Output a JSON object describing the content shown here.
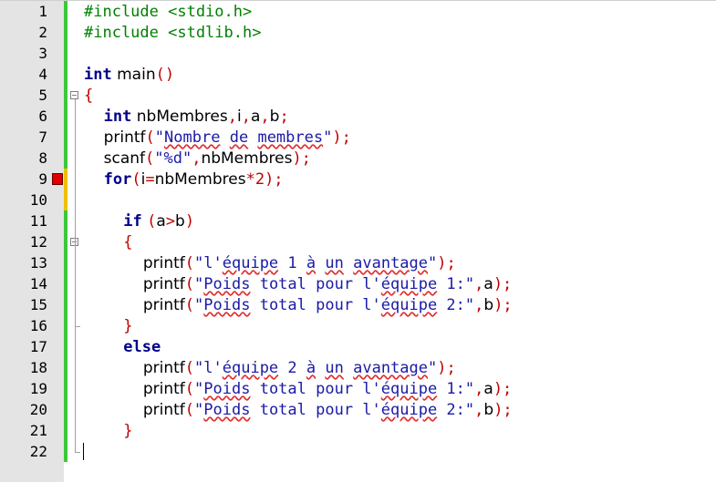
{
  "editor": {
    "line_numbers": [
      "1",
      "2",
      "3",
      "4",
      "5",
      "6",
      "7",
      "8",
      "9",
      "10",
      "11",
      "12",
      "13",
      "14",
      "15",
      "16",
      "17",
      "18",
      "19",
      "20",
      "21",
      "22"
    ],
    "lines": [
      [
        {
          "t": "pre",
          "v": "#include <stdio.h>"
        }
      ],
      [
        {
          "t": "pre",
          "v": "#include <stdlib.h>"
        }
      ],
      [],
      [
        {
          "t": "kw",
          "v": "int"
        },
        {
          "t": "id",
          "v": " main"
        },
        {
          "t": "op",
          "v": "()"
        }
      ],
      [
        {
          "t": "op",
          "v": "{"
        }
      ],
      [
        {
          "t": "id",
          "v": "    "
        },
        {
          "t": "kw",
          "v": "int"
        },
        {
          "t": "id",
          "v": " nbMembres"
        },
        {
          "t": "op",
          "v": ","
        },
        {
          "t": "id",
          "v": "i"
        },
        {
          "t": "op",
          "v": ","
        },
        {
          "t": "id",
          "v": "a"
        },
        {
          "t": "op",
          "v": ","
        },
        {
          "t": "id",
          "v": "b"
        },
        {
          "t": "op",
          "v": ";"
        }
      ],
      [
        {
          "t": "id",
          "v": "    printf"
        },
        {
          "t": "op",
          "v": "("
        },
        {
          "t": "str",
          "v": "\""
        },
        {
          "t": "str",
          "sq": true,
          "v": "Nombre"
        },
        {
          "t": "str",
          "v": " "
        },
        {
          "t": "str",
          "sq": true,
          "v": "de"
        },
        {
          "t": "str",
          "v": " "
        },
        {
          "t": "str",
          "sq": true,
          "v": "membres"
        },
        {
          "t": "str",
          "v": "\""
        },
        {
          "t": "op",
          "v": ");"
        }
      ],
      [
        {
          "t": "id",
          "v": "    scanf"
        },
        {
          "t": "op",
          "v": "("
        },
        {
          "t": "str",
          "v": "\"%d\""
        },
        {
          "t": "op",
          "v": ","
        },
        {
          "t": "id",
          "v": "nbMembres"
        },
        {
          "t": "op",
          "v": ");"
        }
      ],
      [
        {
          "t": "id",
          "v": "    "
        },
        {
          "t": "kw",
          "v": "for"
        },
        {
          "t": "op",
          "v": "("
        },
        {
          "t": "id",
          "v": "i"
        },
        {
          "t": "op",
          "v": "="
        },
        {
          "t": "id",
          "v": "nbMembres"
        },
        {
          "t": "op",
          "v": "*"
        },
        {
          "t": "num",
          "v": "2"
        },
        {
          "t": "op",
          "v": ");"
        }
      ],
      [],
      [
        {
          "t": "id",
          "v": "        "
        },
        {
          "t": "kw",
          "v": "if"
        },
        {
          "t": "id",
          "v": " "
        },
        {
          "t": "op",
          "v": "("
        },
        {
          "t": "id",
          "v": "a"
        },
        {
          "t": "op",
          "v": ">"
        },
        {
          "t": "id",
          "v": "b"
        },
        {
          "t": "op",
          "v": ")"
        }
      ],
      [
        {
          "t": "id",
          "v": "        "
        },
        {
          "t": "op",
          "v": "{"
        }
      ],
      [
        {
          "t": "id",
          "v": "            printf"
        },
        {
          "t": "op",
          "v": "("
        },
        {
          "t": "str",
          "v": "\"l'"
        },
        {
          "t": "str",
          "sq": true,
          "v": "équipe"
        },
        {
          "t": "str",
          "v": " 1 "
        },
        {
          "t": "str",
          "sq": true,
          "v": "à"
        },
        {
          "t": "str",
          "v": " "
        },
        {
          "t": "str",
          "sq": true,
          "v": "un"
        },
        {
          "t": "str",
          "v": " "
        },
        {
          "t": "str",
          "sq": true,
          "v": "avantage"
        },
        {
          "t": "str",
          "v": "\""
        },
        {
          "t": "op",
          "v": ");"
        }
      ],
      [
        {
          "t": "id",
          "v": "            printf"
        },
        {
          "t": "op",
          "v": "("
        },
        {
          "t": "str",
          "v": "\""
        },
        {
          "t": "str",
          "sq": true,
          "v": "Poids"
        },
        {
          "t": "str",
          "v": " total pour l'"
        },
        {
          "t": "str",
          "sq": true,
          "v": "équipe"
        },
        {
          "t": "str",
          "v": " 1:\""
        },
        {
          "t": "op",
          "v": ","
        },
        {
          "t": "id",
          "v": "a"
        },
        {
          "t": "op",
          "v": ");"
        }
      ],
      [
        {
          "t": "id",
          "v": "            printf"
        },
        {
          "t": "op",
          "v": "("
        },
        {
          "t": "str",
          "v": "\""
        },
        {
          "t": "str",
          "sq": true,
          "v": "Poids"
        },
        {
          "t": "str",
          "v": " total pour l'"
        },
        {
          "t": "str",
          "sq": true,
          "v": "équipe"
        },
        {
          "t": "str",
          "v": " 2:\""
        },
        {
          "t": "op",
          "v": ","
        },
        {
          "t": "id",
          "v": "b"
        },
        {
          "t": "op",
          "v": ");"
        }
      ],
      [
        {
          "t": "id",
          "v": "        "
        },
        {
          "t": "op",
          "v": "}"
        }
      ],
      [
        {
          "t": "id",
          "v": "        "
        },
        {
          "t": "kw",
          "v": "else"
        }
      ],
      [
        {
          "t": "id",
          "v": "            printf"
        },
        {
          "t": "op",
          "v": "("
        },
        {
          "t": "str",
          "v": "\"l'"
        },
        {
          "t": "str",
          "sq": true,
          "v": "équipe"
        },
        {
          "t": "str",
          "v": " 2 "
        },
        {
          "t": "str",
          "sq": true,
          "v": "à"
        },
        {
          "t": "str",
          "v": " "
        },
        {
          "t": "str",
          "sq": true,
          "v": "un"
        },
        {
          "t": "str",
          "v": " "
        },
        {
          "t": "str",
          "sq": true,
          "v": "avantage"
        },
        {
          "t": "str",
          "v": "\""
        },
        {
          "t": "op",
          "v": ");"
        }
      ],
      [
        {
          "t": "id",
          "v": "            printf"
        },
        {
          "t": "op",
          "v": "("
        },
        {
          "t": "str",
          "v": "\""
        },
        {
          "t": "str",
          "sq": true,
          "v": "Poids"
        },
        {
          "t": "str",
          "v": " total pour l'"
        },
        {
          "t": "str",
          "sq": true,
          "v": "équipe"
        },
        {
          "t": "str",
          "v": " 1:\""
        },
        {
          "t": "op",
          "v": ","
        },
        {
          "t": "id",
          "v": "a"
        },
        {
          "t": "op",
          "v": ");"
        }
      ],
      [
        {
          "t": "id",
          "v": "            printf"
        },
        {
          "t": "op",
          "v": "("
        },
        {
          "t": "str",
          "v": "\""
        },
        {
          "t": "str",
          "sq": true,
          "v": "Poids"
        },
        {
          "t": "str",
          "v": " total pour l'"
        },
        {
          "t": "str",
          "sq": true,
          "v": "équipe"
        },
        {
          "t": "str",
          "v": " 2:\""
        },
        {
          "t": "op",
          "v": ","
        },
        {
          "t": "id",
          "v": "b"
        },
        {
          "t": "op",
          "v": ");"
        }
      ],
      [
        {
          "t": "id",
          "v": "        "
        },
        {
          "t": "op",
          "v": "}"
        }
      ],
      []
    ],
    "change_markers": [
      "saved",
      "saved",
      "saved",
      "saved",
      "saved",
      "saved",
      "saved",
      "saved",
      "modified",
      "modified",
      "saved",
      "saved",
      "saved",
      "saved",
      "saved",
      "saved",
      "saved",
      "saved",
      "saved",
      "saved",
      "saved",
      "saved"
    ],
    "bookmark_line": 9,
    "fold_open_lines": [
      5,
      12
    ],
    "colors": {
      "saved": "#3cc83c",
      "modified": "#f0c000",
      "preprocessor": "#008000",
      "keyword": "#00008b",
      "operator": "#c00000",
      "string": "#1a1aa6"
    }
  }
}
